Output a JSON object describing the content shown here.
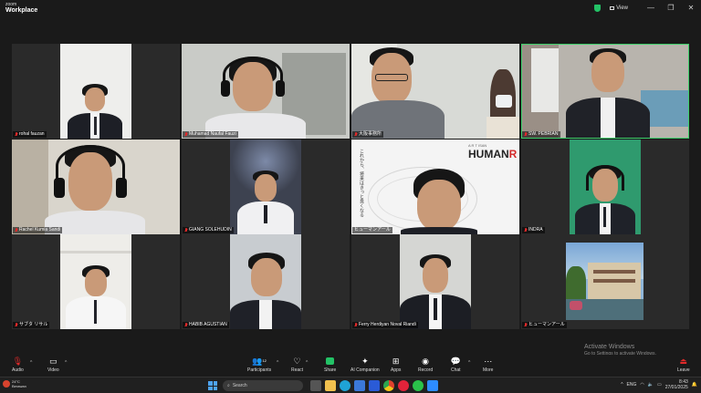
{
  "app": {
    "logo_top": "zoom",
    "logo_bottom": "Workplace",
    "view_label": "View"
  },
  "window_controls": {
    "minimize": "—",
    "restore": "❐",
    "close": "✕"
  },
  "participants": [
    {
      "name": "rohal fauzan",
      "muted": true
    },
    {
      "name": "Muhamad Naufal Fauzi",
      "muted": true
    },
    {
      "name": "大阪事務所",
      "muted": true
    },
    {
      "name": "SW. PEBRIAN",
      "muted": true,
      "active_speaker": true
    },
    {
      "name": "Rachel Kumia Sandi",
      "muted": true
    },
    {
      "name": "GIANG SOLEHUDIN",
      "muted": true
    },
    {
      "name": "ヒューマンアール",
      "muted": false
    },
    {
      "name": "INDRA",
      "muted": true
    },
    {
      "name": "サブタ リサル",
      "muted": true
    },
    {
      "name": "HABIB AGUSTIAN",
      "muted": true
    },
    {
      "name": "Ferry Herdiyan Noval Riandi",
      "muted": true
    },
    {
      "name": "ヒューマンアール",
      "muted": true
    }
  ],
  "slide": {
    "brand_small": "A R T ISAN",
    "brand": "HUMAN",
    "brand_r": "R",
    "vertical_text": "これから、将来はきっと良くなる"
  },
  "toolbar": {
    "audio": "Audio",
    "video": "Video",
    "participants": "Participants",
    "participants_count": "12",
    "react": "React",
    "share": "Share",
    "ai": "AI Companion",
    "apps": "Apps",
    "record": "Record",
    "chat": "Chat",
    "more": "More",
    "leave": "Leave"
  },
  "watermark": {
    "title": "Activate Windows",
    "subtitle": "Go to Settings to activate Windows."
  },
  "taskbar": {
    "temp": "24°C",
    "weather": "Berawan",
    "search_placeholder": "Search",
    "lang": "ENG",
    "time": "8:43",
    "date": "27/01/2025"
  },
  "colors": {
    "active_border": "#3ccf6a",
    "muted_icon": "#e02a2a",
    "share_green": "#23c266",
    "leave_red": "#e02a2a"
  }
}
